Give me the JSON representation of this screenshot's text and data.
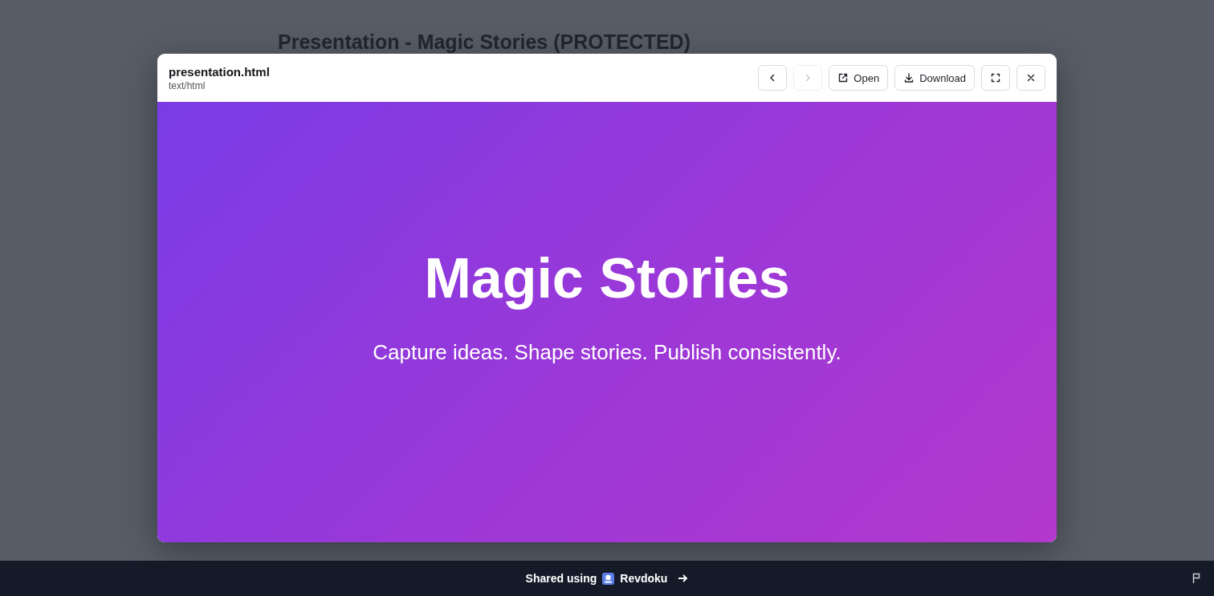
{
  "page": {
    "title": "Presentation - Magic Stories (PROTECTED)"
  },
  "modal": {
    "file_name": "presentation.html",
    "file_type": "text/html",
    "buttons": [
      {
        "kind": "prev",
        "disabled": false
      },
      {
        "kind": "next",
        "disabled": true
      },
      {
        "kind": "open",
        "label": "Open",
        "disabled": false
      },
      {
        "kind": "download",
        "label": "Download",
        "disabled": false
      },
      {
        "kind": "fullscreen",
        "disabled": false
      },
      {
        "kind": "close",
        "disabled": false
      }
    ],
    "slide": {
      "title": "Magic Stories",
      "subtitle": "Capture ideas. Shape stories. Publish consistently."
    }
  },
  "footer": {
    "prefix": "Shared using",
    "brand": "Revdoku"
  }
}
